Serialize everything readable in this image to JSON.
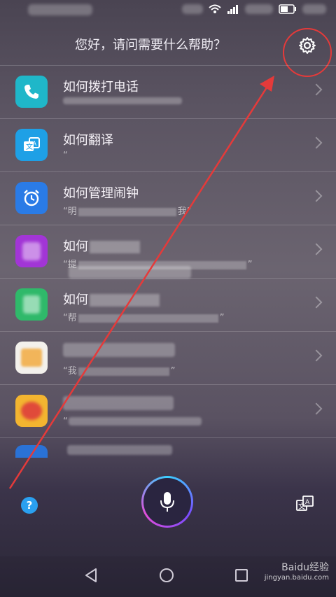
{
  "header": {
    "greeting": "您好，请问需要什么帮助？"
  },
  "list": [
    {
      "title": "如何拨打电话",
      "subtitle": "",
      "icon": "phone-icon",
      "color": "#1fb7c9"
    },
    {
      "title": "如何翻译",
      "subtitle": "“",
      "icon": "translate-icon",
      "color": "#1ea0e6"
    },
    {
      "title": "如何管理闹钟",
      "subtitle": "“明",
      "subtitle_end": "我”",
      "icon": "alarm-icon",
      "color": "#2a7be6"
    },
    {
      "title": "如何",
      "subtitle": "“提",
      "subtitle_end": "”",
      "icon": "app-icon",
      "color": "#a235d6"
    },
    {
      "title": "如何",
      "subtitle": "“帮",
      "subtitle_end": "”",
      "icon": "note-icon",
      "color": "#2fb96a"
    },
    {
      "title": "",
      "subtitle": "“我",
      "subtitle_end": "”",
      "icon": "folder-icon",
      "color": "#f3f1ec"
    },
    {
      "title": "",
      "subtitle": "“",
      "icon": "app-icon",
      "color": "#f3b530"
    },
    {
      "title": "",
      "subtitle": "",
      "icon": "app-icon",
      "color": "#2a72d6"
    }
  ],
  "bottom": {
    "help_label": "?"
  },
  "watermark": {
    "line1": "Baidu经验",
    "line2": "jingyan.baidu.com"
  }
}
